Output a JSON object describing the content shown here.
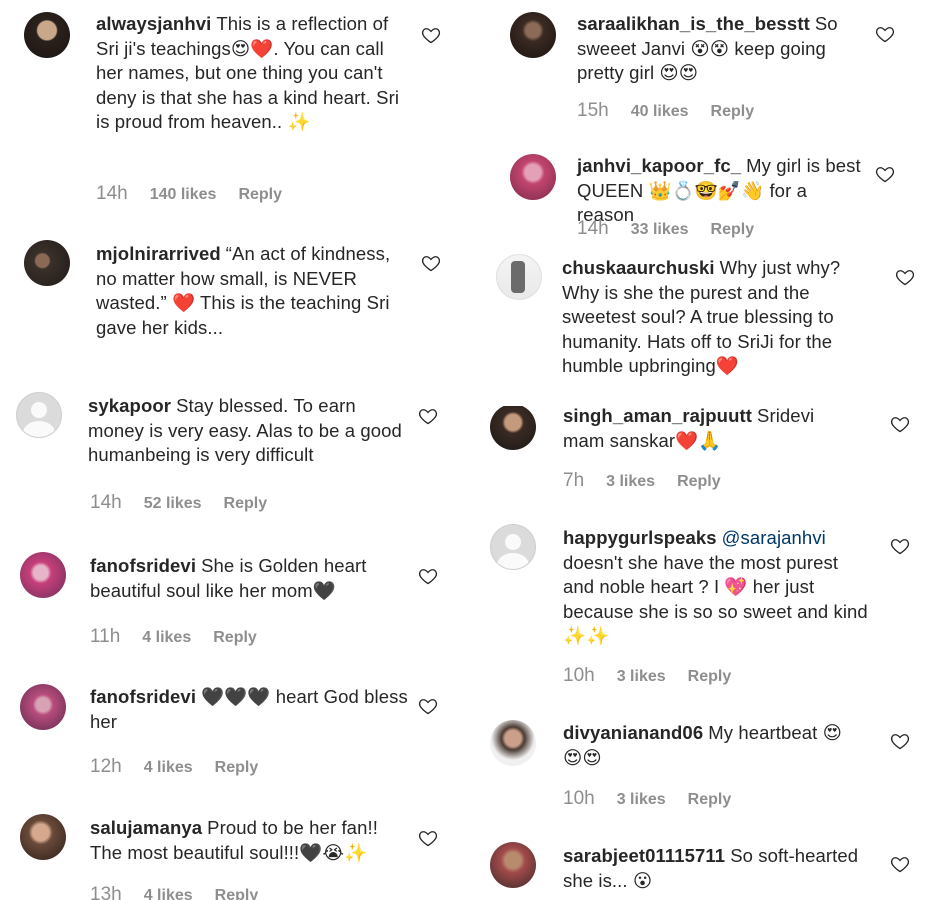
{
  "comments": [
    {
      "username": "alwaysjanhvi",
      "text": "This is a reflection of Sri ji's teachings😍❤️. You can call her names, but one thing you can't deny is that she has a kind heart. Sri is proud from heaven.. ✨",
      "time": "14h",
      "likes": "140 likes",
      "reply": "Reply"
    },
    {
      "username": "mjolnirarrived",
      "text": "“An act of kindness, no matter how small, is NEVER wasted.” ❤️ This is the teaching Sri gave her kids...",
      "time": "",
      "likes": "",
      "reply": ""
    },
    {
      "username": "sykapoor",
      "text": "Stay blessed. To earn money is very easy. Alas to be a good humanbeing is very difficult",
      "time": "14h",
      "likes": "52 likes",
      "reply": "Reply"
    },
    {
      "username": "fanofsridevi",
      "text": "She is Golden heart beautiful soul like her mom🖤",
      "time": "11h",
      "likes": "4 likes",
      "reply": "Reply"
    },
    {
      "username": "fanofsridevi",
      "text": "🖤🖤🖤 heart God bless her",
      "time": "12h",
      "likes": "4 likes",
      "reply": "Reply"
    },
    {
      "username": "salujamanya",
      "text": "Proud to be her fan!! The most beautiful soul!!!🖤😭✨",
      "time": "13h",
      "likes": "4 likes",
      "reply": "Reply"
    },
    {
      "username": "saraalikhan_is_the_besstt",
      "text": "So sweeet Janvi 😵😵 keep going pretty girl 😍😍",
      "time": "15h",
      "likes": "40 likes",
      "reply": "Reply"
    },
    {
      "username": "janhvi_kapoor_fc_",
      "text": "My girl is best QUEEN 👑💍🤓💅👋 for a reason",
      "time": "14h",
      "likes": "33 likes",
      "reply": "Reply"
    },
    {
      "username": "chuskaaurchuski",
      "text": "Why just why? Why is she the purest and the sweetest soul? A true blessing to humanity. Hats off to SriJi for the humble upbringing❤️",
      "time": "",
      "likes": "",
      "reply": ""
    },
    {
      "username": "singh_aman_rajpuutt",
      "text": "Sridevi mam sanskar❤️🙏",
      "time": "7h",
      "likes": "3 likes",
      "reply": "Reply"
    },
    {
      "username": "happygurlspeaks",
      "mention": "@sarajanhvi",
      "text": "doesn't she have the most purest and noble heart ? I 💖 her just because she is so so sweet and kind ✨✨",
      "time": "10h",
      "likes": "3 likes",
      "reply": "Reply"
    },
    {
      "username": "divyanianand06",
      "text": "My heartbeat 😍 😍😍",
      "time": "10h",
      "likes": "3 likes",
      "reply": "Reply"
    },
    {
      "username": "sarabjeet01115711",
      "text": "So soft-hearted she is... 😮",
      "time": "",
      "likes": "",
      "reply": ""
    }
  ],
  "colors": {
    "text": "#262626",
    "meta": "#8e8e8e",
    "mention": "#00376b",
    "heart_emoji": "#d0021b",
    "background": "#ffffff"
  },
  "icons": {
    "like": "heart-outline-icon",
    "avatar_default": "default-avatar-icon"
  }
}
